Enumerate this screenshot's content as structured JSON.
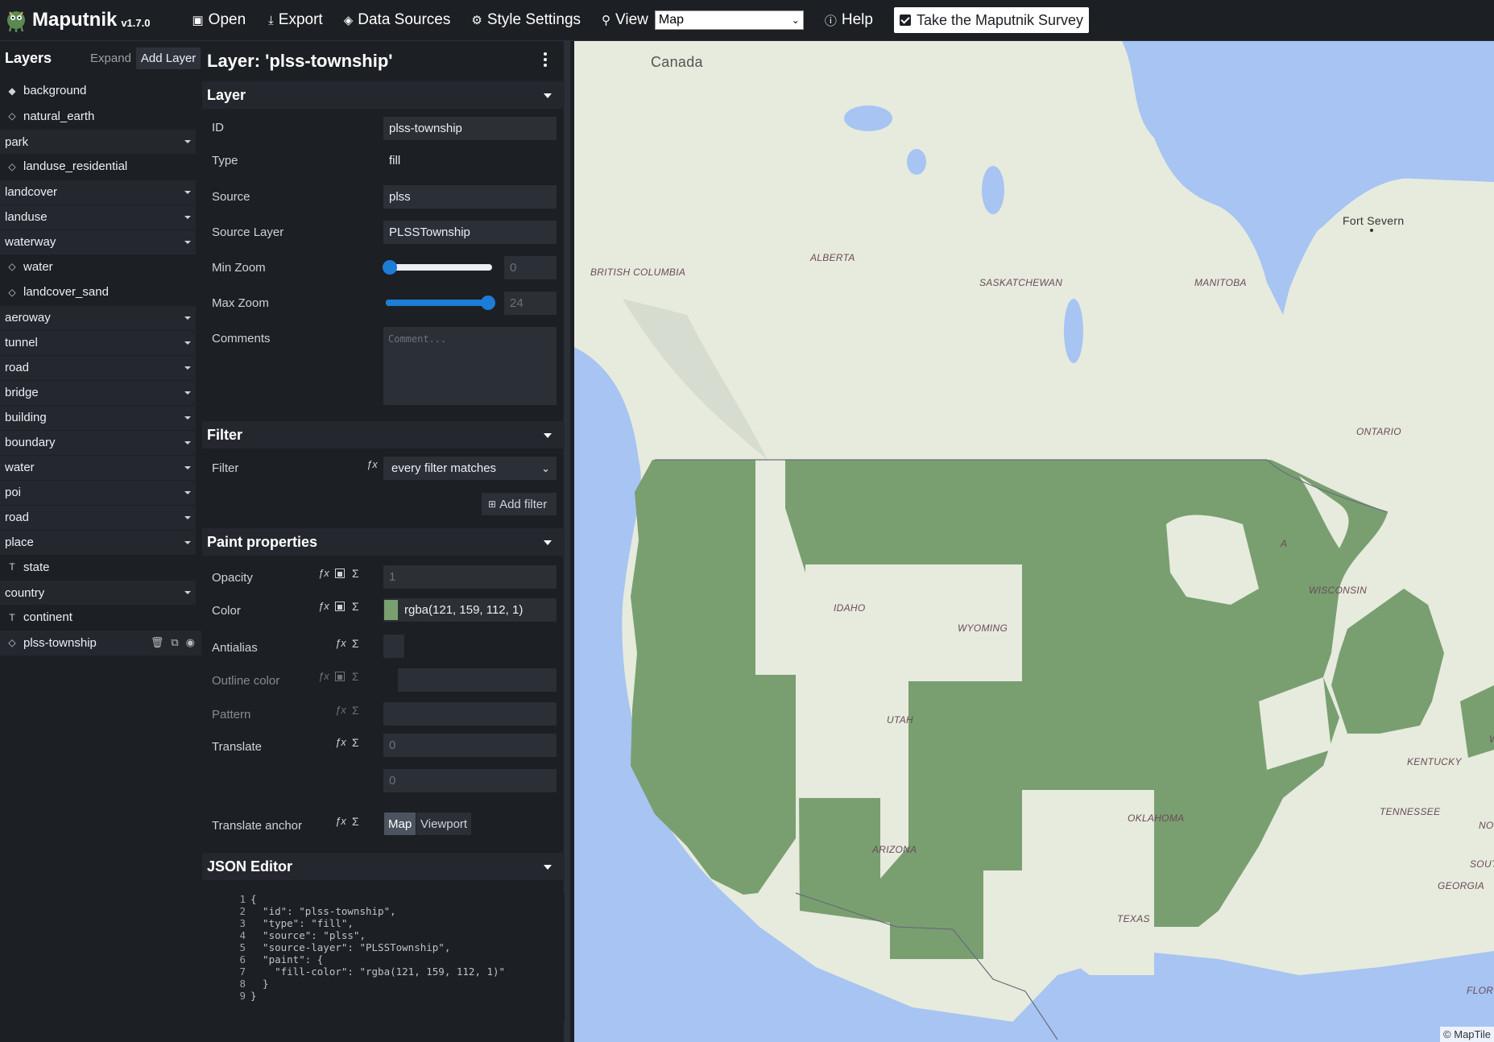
{
  "app": {
    "title": "Maputnik",
    "version": "v1.7.0"
  },
  "toolbar": {
    "open": "Open",
    "export": "Export",
    "data_sources": "Data Sources",
    "style_settings": "Style Settings",
    "view": "View",
    "view_selected": "Map",
    "help": "Help",
    "survey": "Take the Maputnik Survey"
  },
  "layers_panel": {
    "title": "Layers",
    "expand": "Expand",
    "add_layer": "Add Layer",
    "items": [
      {
        "name": "background",
        "kind": "layer",
        "icon": "background-icon"
      },
      {
        "name": "natural_earth",
        "kind": "layer",
        "icon": "raster-icon"
      },
      {
        "name": "park",
        "kind": "group"
      },
      {
        "name": "landuse_residential",
        "kind": "layer",
        "icon": "fill-icon"
      },
      {
        "name": "landcover",
        "kind": "group"
      },
      {
        "name": "landuse",
        "kind": "group"
      },
      {
        "name": "waterway",
        "kind": "group"
      },
      {
        "name": "water",
        "kind": "layer",
        "icon": "fill-icon"
      },
      {
        "name": "landcover_sand",
        "kind": "layer",
        "icon": "fill-icon"
      },
      {
        "name": "aeroway",
        "kind": "group"
      },
      {
        "name": "tunnel",
        "kind": "group"
      },
      {
        "name": "road",
        "kind": "group"
      },
      {
        "name": "bridge",
        "kind": "group"
      },
      {
        "name": "building",
        "kind": "group"
      },
      {
        "name": "boundary",
        "kind": "group"
      },
      {
        "name": "water",
        "kind": "group"
      },
      {
        "name": "poi",
        "kind": "group"
      },
      {
        "name": "road",
        "kind": "group"
      },
      {
        "name": "place",
        "kind": "group"
      },
      {
        "name": "state",
        "kind": "layer",
        "icon": "symbol-icon"
      },
      {
        "name": "country",
        "kind": "group"
      },
      {
        "name": "continent",
        "kind": "layer",
        "icon": "symbol-icon"
      },
      {
        "name": "plss-township",
        "kind": "layer",
        "icon": "fill-icon",
        "active": true
      }
    ]
  },
  "editor": {
    "title": "Layer: 'plss-township'",
    "layer_section": "Layer",
    "id_label": "ID",
    "id_value": "plss-township",
    "type_label": "Type",
    "type_value": "fill",
    "source_label": "Source",
    "source_value": "plss",
    "source_layer_label": "Source Layer",
    "source_layer_value": "PLSSTownship",
    "min_zoom_label": "Min Zoom",
    "min_zoom_value": "0",
    "max_zoom_label": "Max Zoom",
    "max_zoom_value": "24",
    "comments_label": "Comments",
    "comments_placeholder": "Comment...",
    "filter_section": "Filter",
    "filter_label": "Filter",
    "filter_value": "every filter matches",
    "add_filter": "Add filter",
    "paint_section": "Paint properties",
    "opacity_label": "Opacity",
    "opacity_value": "1",
    "color_label": "Color",
    "color_value": "rgba(121, 159, 112, 1)",
    "antialias_label": "Antialias",
    "outline_color_label": "Outline color",
    "pattern_label": "Pattern",
    "translate_label": "Translate",
    "translate_x": "0",
    "translate_y": "0",
    "translate_anchor_label": "Translate anchor",
    "anchor_map": "Map",
    "anchor_viewport": "Viewport",
    "json_section": "JSON Editor",
    "json_lines": [
      "{",
      "  \"id\": \"plss-township\",",
      "  \"type\": \"fill\",",
      "  \"source\": \"plss\",",
      "  \"source-layer\": \"PLSSTownship\",",
      "  \"paint\": {",
      "    \"fill-color\": \"rgba(121, 159, 112, 1)\"",
      "  }",
      "}"
    ]
  },
  "map": {
    "labels": {
      "canada": "Canada",
      "british_columbia": "BRITISH COLUMBIA",
      "alberta": "ALBERTA",
      "saskatchewan": "SASKATCHEWAN",
      "manitoba": "MANITOBA",
      "ontario": "ONTARIO",
      "fort_severn": "Fort Severn",
      "idaho": "IDAHO",
      "wyoming": "WYOMING",
      "utah": "UTAH",
      "arizona": "ARIZONA",
      "oklahoma": "OKLAHOMA",
      "texas": "TEXAS",
      "wisconsin": "WISCONSIN",
      "kentucky": "KENTUCKY",
      "tennessee": "TENNESSEE",
      "georgia": "GEORGIA",
      "flor": "FLOR",
      "nor": "NOR",
      "sout": "SOUT",
      "a": "A",
      "w": "W"
    },
    "attribution": "© MapTile"
  },
  "colors": {
    "fill": "#799f70",
    "water": "#a7c4f2",
    "land": "#e8ece0",
    "accent": "#1c7cd6"
  }
}
